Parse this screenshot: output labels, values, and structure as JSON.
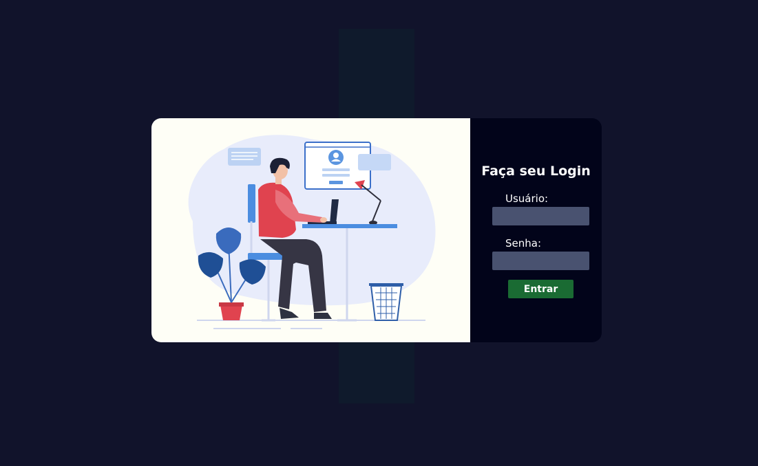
{
  "login": {
    "title": "Faça seu Login",
    "username_label": "Usuário:",
    "username_value": "",
    "password_label": "Senha:",
    "password_value": "",
    "submit_label": "Entrar"
  },
  "colors": {
    "page_background": "#11132b",
    "form_panel": "#02041a",
    "illustration_panel": "#fefef6",
    "input_background": "#495270",
    "button_background": "#1a6b33"
  },
  "illustration": {
    "subject": "person-working-at-computer-illustration",
    "icons": [
      "user-profile-icon",
      "chat-bubble-icon",
      "desk-lamp-icon",
      "plant-icon",
      "trash-bin-icon",
      "laptop-icon"
    ]
  }
}
